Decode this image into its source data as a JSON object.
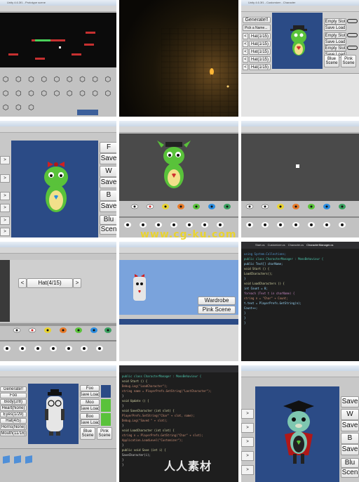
{
  "cells": {
    "c1": {
      "window_title": "Unity 4.6.3f1 - Prototype scene"
    },
    "c3": {
      "window_title": "Unity 4.6.3f1 - Customizer - Character",
      "generate_label": "Generate!!",
      "name_placeholder": "Pick a Name...",
      "left_buttons": [
        "<",
        "<",
        "<",
        "<",
        "<"
      ],
      "hat_labels": [
        "Hat(1/15)",
        "Hat(1/15)",
        "Hat(1/15)",
        "Hat(1/15)",
        "Hat(1/15)"
      ],
      "right_buttons": [
        "Empty Slot",
        "Save Load",
        "Empty Slot",
        "Save Load",
        "Empty Slot",
        "Save Load"
      ],
      "blue_scene": "Blue Scene",
      "pink_scene": "Pink Scene"
    },
    "c4": {
      "right_buttons": [
        "F",
        "Save",
        "W",
        "Save",
        "B",
        "Save",
        "Blu",
        "Scen"
      ],
      "arrows": [
        ">",
        ">",
        ">",
        ">",
        ">",
        ">"
      ]
    },
    "c7": {
      "prev": "<",
      "label": "Hat(4/15)",
      "next": ">"
    },
    "c8": {
      "wardrobe": "Wardrobe",
      "pink_scene": "Pink Scene"
    },
    "c9": {
      "tabs": [
        "Start.cs",
        "Customizer.cs",
        "Character.cs",
        "CharacterManager.cs"
      ],
      "code_lines": [
        "using System.Collections;",
        "",
        "public class CharacterManager : MonoBehaviour {",
        "",
        "  public Text[] charName;",
        "",
        "  void Start () {",
        "    LoadCharacters();",
        "  }",
        "",
        "  void LoadCharacters () {",
        "    int Count = 0;",
        "    foreach (Text t in charName) {",
        "      string n = \"Char\" + Count;",
        "      t.text = PlayerPrefs.GetString(n);",
        "      Count++;",
        "    }",
        "  }",
        "}"
      ]
    },
    "c10": {
      "left_buttons": [
        "Generate!!",
        "Foo",
        "Body(2/8)",
        "Heart(None)",
        "Eyes(1/29)",
        "Hat(4/5)",
        "Horns(None)",
        "Mouth(11/16)"
      ],
      "slots": [
        {
          "name": "Foo",
          "action": "Save Load"
        },
        {
          "name": "Moo",
          "action": "Save Load"
        },
        {
          "name": "Boo",
          "action": "Save Load"
        }
      ],
      "blue_scene": "Blue Scene",
      "pink_scene": "Pink Scene"
    },
    "c11": {
      "code_lines": [
        "public class CharacterManager : MonoBehaviour {",
        "  void Start () {",
        "    Debug.Log(\"LoadCharacter\");",
        "    string name = PlayerPrefs.GetString(\"LastCharacter\");",
        "  }",
        "",
        "  void Update () {",
        "  }",
        "",
        "  void SaveCharacter (int slot) {",
        "    PlayerPrefs.SetString(\"Char\" + slot, name);",
        "    Debug.Log(\"Saved \" + slot);",
        "  }",
        "",
        "  void LoadCharacter (int slot) {",
        "    string n = PlayerPrefs.GetString(\"Char\" + slot);",
        "    Application.LoadLevel(\"Customizer\");",
        "  }",
        "",
        "  public void Save (int i) {",
        "    SaveCharacter(i);",
        "  }",
        "}"
      ]
    },
    "c12": {
      "right_buttons": [
        "Save",
        "W",
        "Save",
        "B",
        "Save",
        "Blu",
        "Scen"
      ],
      "arrows": [
        ">",
        ">",
        ">",
        ">",
        ">"
      ]
    }
  },
  "watermarks": {
    "site": "www.cg-ku.com",
    "logo": "人人素材"
  },
  "colors": {
    "scene_blue": "#2b4b86",
    "editor_gray": "#c2c2c2",
    "code_bg": "#1e1e1e",
    "sky": "#7aa3dc",
    "monster_green": "#59c23a"
  }
}
